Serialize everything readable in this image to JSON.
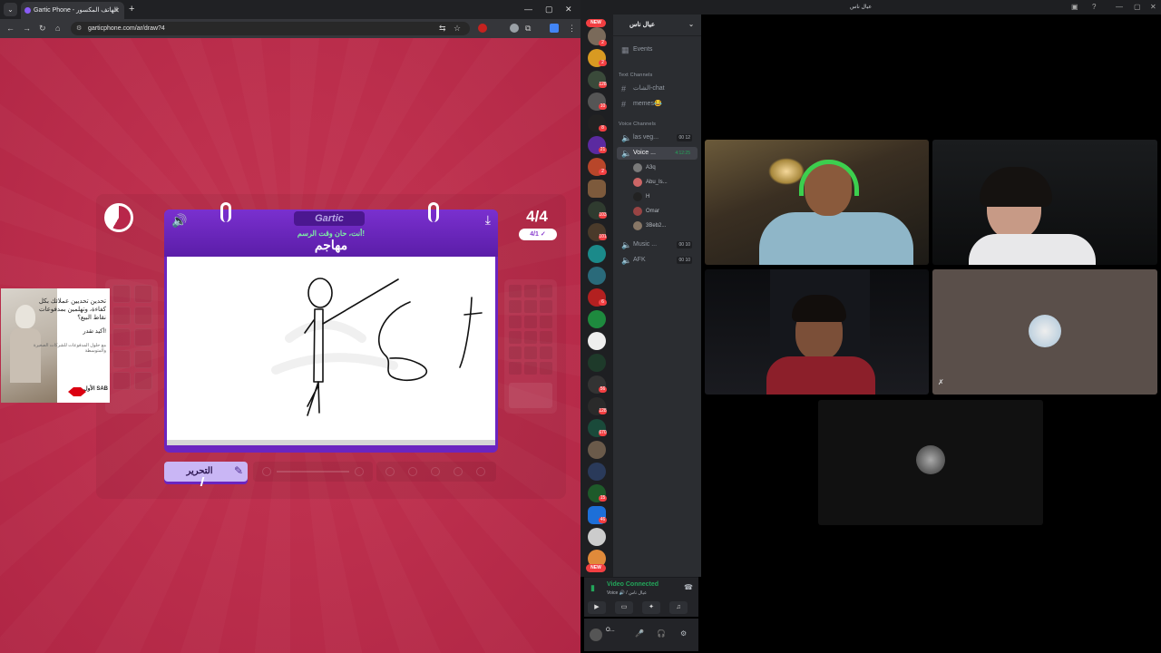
{
  "browser": {
    "tab_title": "Gartic Phone - الهاتف المكسور",
    "url": "garticphone.com/ar/draw?4",
    "new_tab": "+",
    "close_tab": "✕",
    "win_min": "—",
    "win_max": "▢",
    "win_close": "✕"
  },
  "game": {
    "round": "4/4",
    "progress": "4/1 ✓",
    "logo": "Gartic",
    "prompt": "أنت، حان وقت الرسم!",
    "word": "مهاجم",
    "edit_button": "التحرير",
    "accent_color": "#6b25c0",
    "background_color": "#c23552"
  },
  "ad": {
    "headline": "تحدين تحديين عملائك بكل كفاءة، وتهلمين بمدفوعات نقاط البيع؟",
    "cta": "أكيد تقدر!",
    "sub": "مع حلول المدفوعات للشركات الصغيرة والمتوسطة",
    "brand": "الأول SAB"
  },
  "discord": {
    "window_title": "عيال ناس",
    "server_name": "عيال ناس",
    "events": "Events",
    "text_channels": "Text Channels",
    "voice_channels": "Voice Channels",
    "channels": [
      {
        "name": "الشات-chat"
      },
      {
        "name": "memes😂"
      }
    ],
    "voice": [
      {
        "name": "las veg...",
        "count": "00",
        "limit": "12"
      },
      {
        "name": "Voice ...",
        "time": "4:12:25"
      },
      {
        "name": "Music ...",
        "count": "00",
        "limit": "10"
      },
      {
        "name": "AFK",
        "count": "00",
        "limit": "10"
      }
    ],
    "members": [
      "A3q",
      "Abu_Is...",
      "H",
      "Omar",
      "3Beb2..."
    ],
    "badges": [
      "2",
      "2",
      "128",
      "10",
      "8",
      "21",
      "2",
      "103",
      "101",
      "6",
      "56",
      "128",
      "670",
      "15",
      "46",
      "6"
    ],
    "new_label": "NEW",
    "video_connected": "Video Connected",
    "voice_sub": "Voice 🔊 / عيال ناس",
    "user": "O..."
  }
}
